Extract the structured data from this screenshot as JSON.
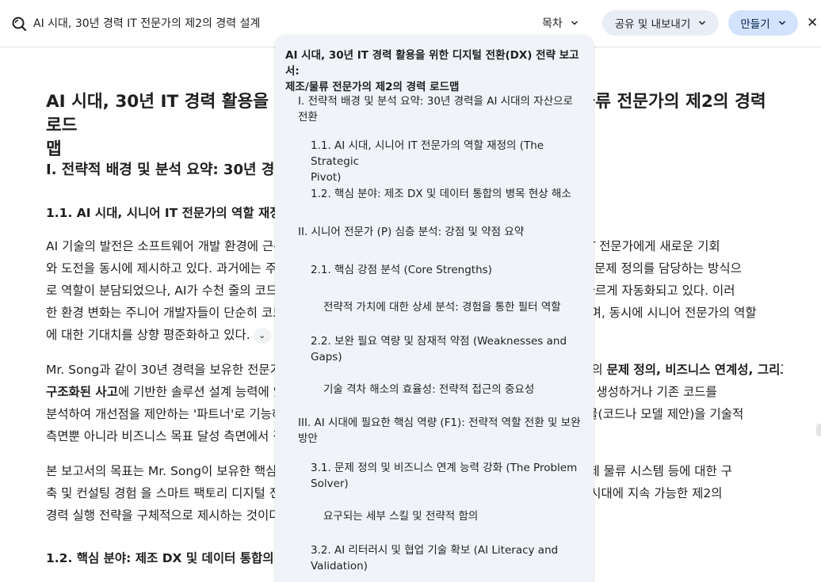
{
  "header": {
    "doc_title": "AI 시대, 30년 경력 IT 전문가의 제2의 경력 설계",
    "toc_label": "목차",
    "share_label": "공유 및 내보내기",
    "make_label": "만들기",
    "close_glyph": "✕"
  },
  "document": {
    "title": "AI 시대, 30년 IT 경력 활용을 위한 디지털 전환(DX) 전략 보고서: 제조/물류 전문가의 제2의 경력 로드\n맵",
    "section1_heading": "I. 전략적 배경 및 분석 요약: 30년 경력을 AI 시대의 자산으로 전환",
    "sub11_heading": "1.1. AI 시대, 시니어 IT 전문가의 역할 재정의 (The Strategic Pivot)",
    "para1": [
      "AI 기술의 발전은 소프트웨어 개발 환경에 근본적인 변화를 가져왔으며, 이는 30년 경력을 보유한 시니어 IT 전문가에게 새로운 기회",
      "와 도전을 동시에 제시하고 있다. 과거에는 주니어 개발자가 코딩을 담당하고, 시니어 전문가가 설계 검토와 문제 정의를 담당하는 방식으",
      "로 역할이 분담되었으나, AI가 수천 줄의 코드를 순식간에 생성하게 되면서 단순 구현 중심의 업무 영역은 빠르게 자동화되고 있다. 이러",
      "한 환경 변화는 주니어 개발자들이 단순히 코드를 작성하는 것만으로는 경쟁력을 유지하기 어렵게 만들었으며, 동시에 시니어 전문가의 역할",
      "에 대한 기대치를 상향 평준화하고 있다."
    ],
    "para2_line1_plain": "Mr. Song과 같이 30년 경력을 보유한 전문가의 핵심 경쟁력은 단순 코딩 능력이 아니라, 축적된 경험 기반의 ",
    "para2_line1_bold": "문제 정의, 비즈니스 연계성, 그리고",
    "para2_line2_bold": "구조화된 사고",
    "para2_line2_plain": "에 기반한 솔루션 설계 능력에 있다. AI 시대의 시니어 전문가는 AI를 활용하여 대량의 코드를 생성하거나 기존 코드를",
    "para2_rest": [
      "분석하여 개선점을 제안하는 '파트너'로 기능하며, 그 대신 AI가 생성한 결과물의 방향을 설정하고, 그 결과물(코드나 모델 제안)을 기술적",
      "측면뿐 아니라 비즈니스 목표 달성 측면에서 검증하는 역할을 수행해야 한다."
    ],
    "para3": [
      "본 보고서의 목표는 Mr. Song이 보유한 핵심 경험인 제조 실행 시스템(MES), 전사적 자원 관리(ERP), 국제 물류 시스템 등에 대한 구",
      "축 및 컨설팅 경험 을 스마트 팩토리 디지털 전환(DX) 시장의 요구 사항 및 AI 기술 트렌드와 연결하여, AI 시대에 지속 가능한 제2의",
      "경력 실행 전략을 구체적으로 제시하는 것이다."
    ],
    "sub12_heading": "1.2. 핵심 분야: 제조 DX 및 데이터 통합의 병목 현상 해소",
    "expand_glyph": "⌄"
  },
  "toc": {
    "title": "AI 시대, 30년 IT 경력 활용을 위한 디지털 전환(DX) 전략 보고서:\n제조/물류 전문가의 제2의 경력 로드맵",
    "items": [
      {
        "label": "I. 전략적 배경 및 분석 요약: 30년 경력을 AI 시대의 자산으로\n전환"
      },
      {
        "label": "1.1. AI 시대, 시니어 IT 전문가의 역할 재정의 (The Strategic\nPivot)"
      },
      {
        "label": "1.2. 핵심 분야: 제조 DX 및 데이터 통합의 병목 현상 해소"
      },
      {
        "label": "II. 시니어 전문가 (P) 심층 분석: 강점 및 약점 요약"
      },
      {
        "label": "2.1. 핵심 강점 분석 (Core Strengths)"
      },
      {
        "label": "전략적 가치에 대한 상세 분석: 경험을 통한 필터 역할"
      },
      {
        "label": "2.2. 보완 필요 역량 및 잠재적 약점 (Weaknesses and\nGaps)"
      },
      {
        "label": "기술 격차 해소의 효율성: 전략적 접근의 중요성"
      },
      {
        "label": "III. AI 시대에 필요한 핵심 역량 (F1): 전략적 역할 전환 및 보완\n방안"
      },
      {
        "label": "3.1. 문제 정의 및 비즈니스 연계 능력 강화 (The Problem\nSolver)"
      },
      {
        "label": "요구되는 세부 스킬 및 전략적 함의"
      },
      {
        "label": "3.2. AI 리터러시 및 협업 기술 확보 (AI Literacy and\nValidation)"
      }
    ]
  }
}
